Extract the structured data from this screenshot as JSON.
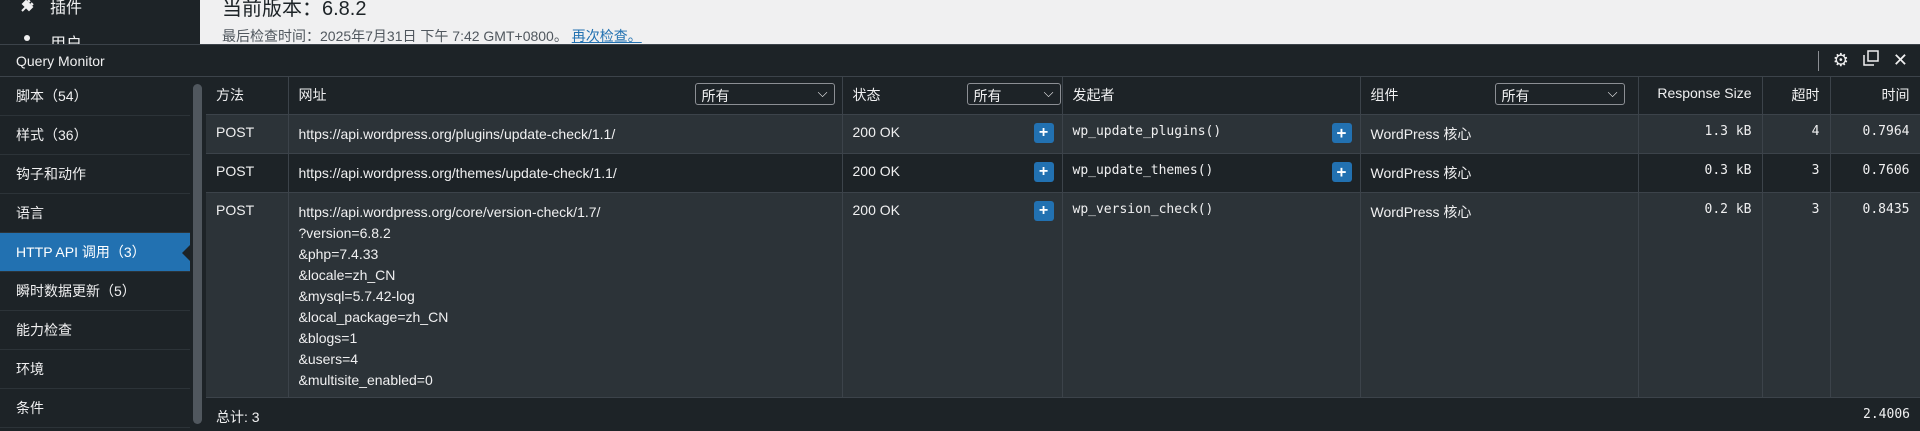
{
  "wp_sidebar": {
    "items": [
      {
        "label": "插件"
      },
      {
        "label": "用户"
      }
    ]
  },
  "wp_content": {
    "version_title": "当前版本：6.8.2",
    "last_checked": "最后检查时间：2025年7月31日 下午 7:42 GMT+0800。",
    "recheck_link": "再次检查。"
  },
  "qm": {
    "title": "Query Monitor",
    "nav": [
      {
        "label": "脚本（54）"
      },
      {
        "label": "样式（36）"
      },
      {
        "label": "钩子和动作"
      },
      {
        "label": "语言"
      },
      {
        "label": "HTTP API 调用（3）",
        "active": true
      },
      {
        "label": "瞬时数据更新（5）"
      },
      {
        "label": "能力检查"
      },
      {
        "label": "环境"
      },
      {
        "label": "条件"
      }
    ],
    "headers": {
      "method": "方法",
      "url": "网址",
      "url_filter": "所有",
      "status": "状态",
      "status_filter": "所有",
      "caller": "发起者",
      "component": "组件",
      "component_filter": "所有",
      "response_size": "Response Size",
      "timeout": "超时",
      "time": "时间"
    },
    "rows": [
      {
        "method": "POST",
        "url_lines": [
          "https://api.wordpress.org/plugins/update-check/1.1/"
        ],
        "status": "200 OK",
        "caller": "wp_update_plugins()",
        "component": "WordPress 核心",
        "size": "1.3 kB",
        "timeout": "4",
        "time": "0.7964"
      },
      {
        "method": "POST",
        "url_lines": [
          "https://api.wordpress.org/themes/update-check/1.1/"
        ],
        "status": "200 OK",
        "caller": "wp_update_themes()",
        "component": "WordPress 核心",
        "size": "0.3 kB",
        "timeout": "3",
        "time": "0.7606"
      },
      {
        "method": "POST",
        "url_lines": [
          "https://api.wordpress.org/core/version-check/1.7/",
          "?version=6.8.2",
          "&php=7.4.33",
          "&locale=zh_CN",
          "&mysql=5.7.42-log",
          "&local_package=zh_CN",
          "&blogs=1",
          "&users=4",
          "&multisite_enabled=0"
        ],
        "status": "200 OK",
        "caller": "wp_version_check()",
        "component": "WordPress 核心",
        "size": "0.2 kB",
        "timeout": "3",
        "time": "0.8435"
      }
    ],
    "footer": {
      "total": "总计: 3",
      "total_time": "2.4006"
    }
  }
}
